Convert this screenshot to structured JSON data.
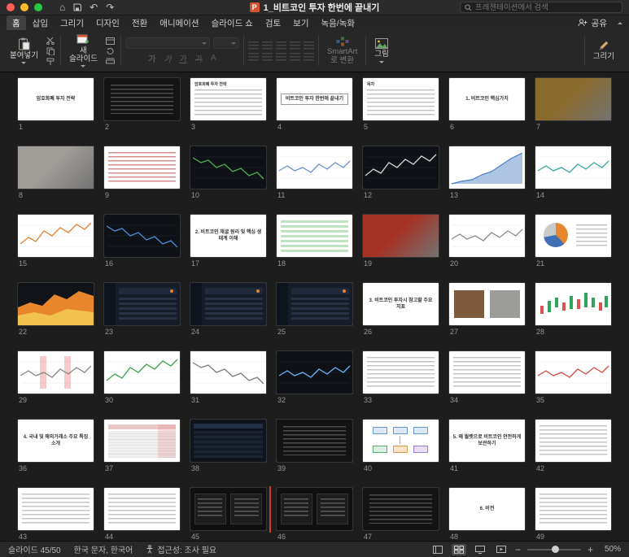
{
  "titlebar": {
    "title": "1_비트코인 투자 한번에 끝내기",
    "search_placeholder": "프레젠테이션에서 검색"
  },
  "tabs": [
    "홈",
    "삽입",
    "그리기",
    "디자인",
    "전환",
    "애니메이션",
    "슬라이드 쇼",
    "검토",
    "보기",
    "녹음/녹화"
  ],
  "active_tab_index": 0,
  "share_label": "공유",
  "ribbon": {
    "paste_label": "붙여넣기",
    "new_slide_label": "새\n슬라이드",
    "smartart_label": "SmartArt\n로 변환",
    "picture_label": "그림",
    "draw_label": "그리기",
    "font_glyphs": [
      "가",
      "가",
      "가",
      "가",
      "A"
    ]
  },
  "statusbar": {
    "slide_counter": "슬라이드 45/50",
    "language": "한국 문자, 한국어",
    "accessibility": "접근성: 조사 필요",
    "zoom": "50%"
  },
  "current_slide": 45,
  "slide_count": 50,
  "insertion_after_slide": 45,
  "colors": {
    "accent": "#d35230",
    "insertion_line": "#cc4125"
  },
  "slides": [
    {
      "n": 1,
      "kind": "title",
      "title": "암호화폐 투자 전략"
    },
    {
      "n": 2,
      "kind": "dark-shot"
    },
    {
      "n": 3,
      "kind": "doc",
      "title": "암호화폐 투자 전략"
    },
    {
      "n": 4,
      "kind": "title-box",
      "title": "비트코인 투자 한번에 끝내기"
    },
    {
      "n": 5,
      "kind": "doc",
      "title": "목차"
    },
    {
      "n": 6,
      "kind": "title",
      "title": "1. 비트코인 핵심가치"
    },
    {
      "n": 7,
      "kind": "photo",
      "color": "#8a6b2e"
    },
    {
      "n": 8,
      "kind": "photo",
      "color": "#a09d98"
    },
    {
      "n": 9,
      "kind": "doc-red"
    },
    {
      "n": 10,
      "kind": "dark-chart",
      "color": "#4caf50"
    },
    {
      "n": 11,
      "kind": "chart-line",
      "color": "#6b8fc9"
    },
    {
      "n": 12,
      "kind": "dark-chart",
      "color": "#d8d8d8"
    },
    {
      "n": 13,
      "kind": "chart-area",
      "color": "#4a7fc1"
    },
    {
      "n": 14,
      "kind": "chart-line",
      "color": "#3aa79f"
    },
    {
      "n": 15,
      "kind": "chart-line",
      "color": "#e0812f"
    },
    {
      "n": 16,
      "kind": "dark-chart",
      "color": "#4a90d9"
    },
    {
      "n": 17,
      "kind": "title",
      "title": "2. 비트코인 채굴 원리 및 핵심 생태계 이해"
    },
    {
      "n": 18,
      "kind": "doc-green"
    },
    {
      "n": 19,
      "kind": "photo",
      "color": "#a63226"
    },
    {
      "n": 20,
      "kind": "chart-line",
      "color": "#8a8a8a"
    },
    {
      "n": 21,
      "kind": "pie"
    },
    {
      "n": 22,
      "kind": "dark-area"
    },
    {
      "n": 23,
      "kind": "dark-dash"
    },
    {
      "n": 24,
      "kind": "dark-dash"
    },
    {
      "n": 25,
      "kind": "dark-dash"
    },
    {
      "n": 26,
      "kind": "title",
      "title": "3. 비트코인 투자시 참고할 주요 지표"
    },
    {
      "n": 27,
      "kind": "photo-split"
    },
    {
      "n": 28,
      "kind": "candles"
    },
    {
      "n": 29,
      "kind": "chart-band",
      "color": "#888888"
    },
    {
      "n": 30,
      "kind": "chart-line",
      "color": "#3f9e4d"
    },
    {
      "n": 31,
      "kind": "chart-line",
      "color": "#7a7a7a"
    },
    {
      "n": 32,
      "kind": "dark-chart",
      "color": "#6fb3ff"
    },
    {
      "n": 33,
      "kind": "doc"
    },
    {
      "n": 34,
      "kind": "doc"
    },
    {
      "n": 35,
      "kind": "chart-line",
      "color": "#d24b3f"
    },
    {
      "n": 36,
      "kind": "title",
      "title": "4. 국내 및 해외거래소 주요 특징 소개"
    },
    {
      "n": 37,
      "kind": "table"
    },
    {
      "n": 38,
      "kind": "dark-table"
    },
    {
      "n": 39,
      "kind": "dark-shot"
    },
    {
      "n": 40,
      "kind": "diagram"
    },
    {
      "n": 41,
      "kind": "title",
      "title": "5. 왜 월렛으로 비트코인 안전하게 보관하기"
    },
    {
      "n": 42,
      "kind": "doc"
    },
    {
      "n": 43,
      "kind": "doc"
    },
    {
      "n": 44,
      "kind": "doc"
    },
    {
      "n": 45,
      "kind": "duo-dark"
    },
    {
      "n": 46,
      "kind": "duo-dark"
    },
    {
      "n": 47,
      "kind": "dark-shot"
    },
    {
      "n": 48,
      "kind": "title",
      "title": "6. 비전"
    },
    {
      "n": 49,
      "kind": "doc"
    }
  ]
}
